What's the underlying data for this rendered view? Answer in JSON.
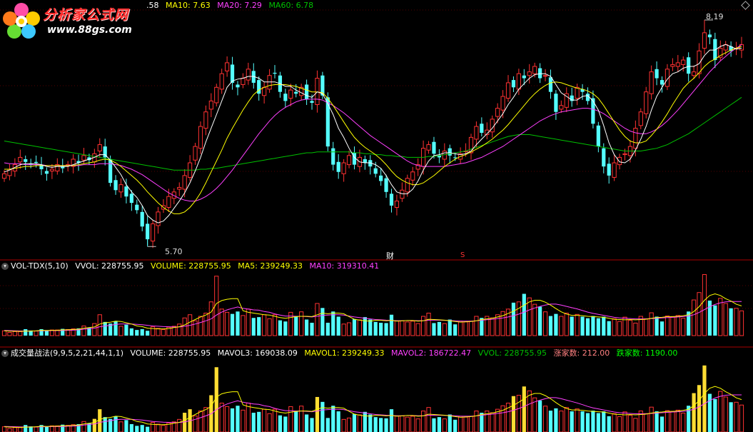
{
  "main_header": {
    "ma5_tail": ".58",
    "ma10": "MA10: 7.63",
    "ma20": "MA20: 7.29",
    "ma60": "MA60: 6.78"
  },
  "logo": {
    "title": "分析家公式网",
    "url": "www.88gs.com"
  },
  "price_labels": {
    "high": "8.19",
    "low": "5.70",
    "event_cai": "财",
    "event_s": "S"
  },
  "vol_header": {
    "name": "VOL-TDX(5,10)",
    "vvol": "VVOL: 228755.95",
    "volume": "VOLUME: 228755.95",
    "ma5": "MA5: 239249.33",
    "ma10": "MA10: 319310.41"
  },
  "strategy_header": {
    "name": "成交量战法(9,9,5,2,21,44,1,1)",
    "volume": "VOLUME: 228755.95",
    "mavol3": "MAVOL3: 169038.09",
    "mavol1": "MAVOL1: 239249.33",
    "mavol2": "MAVOL2: 186722.47",
    "vvol": "VVOL: 228755.95",
    "up": "涨家数: 212.00",
    "down": "跌家数: 1190.00"
  },
  "colors": {
    "up": "#ff3232",
    "down": "#54ffff",
    "ma5": "#ffffff",
    "ma10": "#ffff00",
    "ma20": "#ff40ff",
    "ma60": "#00c000",
    "separator": "#aa0000"
  },
  "chart_data": {
    "type": "candlestick",
    "price_range": [
      5.6,
      8.3
    ],
    "high_marker": 8.19,
    "low_marker": 5.7,
    "closes": [
      6.5,
      6.55,
      6.6,
      6.68,
      6.63,
      6.6,
      6.62,
      6.55,
      6.5,
      6.55,
      6.6,
      6.56,
      6.6,
      6.66,
      6.62,
      6.7,
      6.65,
      6.72,
      6.82,
      6.68,
      6.4,
      6.32,
      6.38,
      6.25,
      6.18,
      6.1,
      5.92,
      5.78,
      5.95,
      6.08,
      6.15,
      6.25,
      6.3,
      6.35,
      6.48,
      6.62,
      6.8,
      7.02,
      7.18,
      7.3,
      7.45,
      7.6,
      7.72,
      7.5,
      7.45,
      7.55,
      7.65,
      7.5,
      7.38,
      7.45,
      7.58,
      7.6,
      7.4,
      7.3,
      7.42,
      7.38,
      7.45,
      7.32,
      7.28,
      7.55,
      7.36,
      6.8,
      6.6,
      6.52,
      6.62,
      6.7,
      6.6,
      6.68,
      6.62,
      6.58,
      6.5,
      6.42,
      6.3,
      6.15,
      6.2,
      6.32,
      6.45,
      6.52,
      6.6,
      6.78,
      6.82,
      6.72,
      6.68,
      6.75,
      6.7,
      6.68,
      6.72,
      6.75,
      6.9,
      7.02,
      6.95,
      6.98,
      7.1,
      7.22,
      7.35,
      7.5,
      7.45,
      7.6,
      7.55,
      7.62,
      7.68,
      7.55,
      7.58,
      7.4,
      7.18,
      7.25,
      7.38,
      7.3,
      7.45,
      7.4,
      7.3,
      7.05,
      6.8,
      6.58,
      6.48,
      6.62,
      6.68,
      6.72,
      6.8,
      7.0,
      7.18,
      7.4,
      7.62,
      7.55,
      7.48,
      7.65,
      7.7,
      7.72,
      7.75,
      7.6,
      7.62,
      7.85,
      8.05,
      8.0,
      7.75,
      7.88,
      7.92,
      7.85,
      7.88,
      7.92
    ],
    "ma5": [
      6.52,
      6.54,
      6.57,
      6.6,
      6.61,
      6.61,
      6.61,
      6.6,
      6.58,
      6.57,
      6.58,
      6.58,
      6.58,
      6.6,
      6.62,
      6.64,
      6.66,
      6.68,
      6.71,
      6.71,
      6.65,
      6.57,
      6.49,
      6.38,
      6.3,
      6.24,
      6.15,
      6.04,
      5.99,
      5.96,
      5.98,
      6.04,
      6.12,
      6.2,
      6.29,
      6.4,
      6.53,
      6.68,
      6.85,
      7.0,
      7.15,
      7.3,
      7.45,
      7.52,
      7.54,
      7.55,
      7.57,
      7.57,
      7.55,
      7.51,
      7.51,
      7.51,
      7.49,
      7.46,
      7.46,
      7.42,
      7.39,
      7.36,
      7.34,
      7.4,
      7.38,
      7.27,
      7.15,
      7.0,
      6.9,
      6.78,
      6.68,
      6.63,
      6.62,
      6.62,
      6.6,
      6.56,
      6.48,
      6.38,
      6.3,
      6.28,
      6.28,
      6.33,
      6.42,
      6.54,
      6.64,
      6.7,
      6.71,
      6.73,
      6.73,
      6.72,
      6.71,
      6.72,
      6.75,
      6.82,
      6.88,
      6.94,
      7.0,
      7.08,
      7.16,
      7.26,
      7.34,
      7.43,
      7.49,
      7.55,
      7.59,
      7.6,
      7.6,
      7.57,
      7.48,
      7.39,
      7.35,
      7.31,
      7.31,
      7.35,
      7.36,
      7.3,
      7.2,
      7.03,
      6.84,
      6.71,
      6.63,
      6.62,
      6.66,
      6.76,
      6.88,
      7.02,
      7.2,
      7.35,
      7.45,
      7.54,
      7.6,
      7.62,
      7.66,
      7.68,
      7.68,
      7.71,
      7.8,
      7.86,
      7.86,
      7.9,
      7.92,
      7.9,
      7.87,
      7.88
    ],
    "ma10": [
      6.55,
      6.55,
      6.56,
      6.57,
      6.58,
      6.58,
      6.59,
      6.59,
      6.59,
      6.59,
      6.59,
      6.59,
      6.59,
      6.59,
      6.6,
      6.61,
      6.62,
      6.63,
      6.65,
      6.66,
      6.65,
      6.62,
      6.58,
      6.53,
      6.48,
      6.43,
      6.37,
      6.3,
      6.24,
      6.18,
      6.13,
      6.09,
      6.06,
      6.06,
      6.08,
      6.13,
      6.2,
      6.29,
      6.4,
      6.52,
      6.64,
      6.76,
      6.89,
      7.0,
      7.1,
      7.2,
      7.29,
      7.37,
      7.42,
      7.45,
      7.47,
      7.48,
      7.48,
      7.48,
      7.47,
      7.46,
      7.44,
      7.42,
      7.4,
      7.4,
      7.39,
      7.33,
      7.25,
      7.16,
      7.07,
      6.98,
      6.9,
      6.84,
      6.79,
      6.75,
      6.71,
      6.66,
      6.6,
      6.53,
      6.47,
      6.43,
      6.4,
      6.38,
      6.38,
      6.4,
      6.44,
      6.48,
      6.53,
      6.58,
      6.62,
      6.66,
      6.69,
      6.71,
      6.74,
      6.77,
      6.8,
      6.84,
      6.88,
      6.93,
      6.98,
      7.04,
      7.11,
      7.18,
      7.25,
      7.32,
      7.38,
      7.43,
      7.47,
      7.5,
      7.51,
      7.5,
      7.48,
      7.46,
      7.44,
      7.43,
      7.41,
      7.38,
      7.33,
      7.25,
      7.16,
      7.07,
      6.98,
      6.91,
      6.86,
      6.84,
      6.84,
      6.86,
      6.92,
      6.99,
      7.07,
      7.16,
      7.26,
      7.35,
      7.44,
      7.5,
      7.55,
      7.61,
      7.68,
      7.73,
      7.76,
      7.8,
      7.83,
      7.86,
      7.88,
      7.9
    ],
    "ma20": [
      6.62,
      6.61,
      6.61,
      6.61,
      6.6,
      6.6,
      6.6,
      6.6,
      6.59,
      6.59,
      6.59,
      6.59,
      6.59,
      6.59,
      6.59,
      6.6,
      6.6,
      6.6,
      6.61,
      6.61,
      6.61,
      6.6,
      6.59,
      6.57,
      6.55,
      6.52,
      6.49,
      6.45,
      6.41,
      6.37,
      6.33,
      6.29,
      6.26,
      6.23,
      6.21,
      6.2,
      6.2,
      6.22,
      6.25,
      6.29,
      6.34,
      6.4,
      6.47,
      6.54,
      6.62,
      6.7,
      6.78,
      6.86,
      6.94,
      7.01,
      7.08,
      7.14,
      7.19,
      7.23,
      7.26,
      7.29,
      7.31,
      7.32,
      7.32,
      7.32,
      7.31,
      7.28,
      7.25,
      7.21,
      7.17,
      7.12,
      7.07,
      7.02,
      6.97,
      6.92,
      6.88,
      6.84,
      6.8,
      6.76,
      6.72,
      6.68,
      6.64,
      6.61,
      6.59,
      6.58,
      6.58,
      6.58,
      6.58,
      6.58,
      6.59,
      6.6,
      6.61,
      6.62,
      6.64,
      6.66,
      6.68,
      6.71,
      6.74,
      6.77,
      6.8,
      6.84,
      6.88,
      6.92,
      6.96,
      7.0,
      7.04,
      7.08,
      7.11,
      7.14,
      7.16,
      7.18,
      7.19,
      7.2,
      7.21,
      7.22,
      7.22,
      7.21,
      7.19,
      7.16,
      7.12,
      7.08,
      7.04,
      7.0,
      6.97,
      6.95,
      6.94,
      6.94,
      6.96,
      6.99,
      7.03,
      7.08,
      7.14,
      7.2,
      7.27,
      7.34,
      7.41,
      7.48,
      7.55,
      7.62,
      7.68,
      7.74,
      7.79,
      7.84,
      7.88,
      7.92
    ],
    "ma60": [
      6.86,
      6.85,
      6.84,
      6.83,
      6.82,
      6.81,
      6.8,
      6.79,
      6.78,
      6.77,
      6.76,
      6.75,
      6.74,
      6.73,
      6.72,
      6.71,
      6.7,
      6.69,
      6.68,
      6.67,
      6.66,
      6.65,
      6.64,
      6.63,
      6.62,
      6.61,
      6.6,
      6.59,
      6.58,
      6.57,
      6.56,
      6.55,
      6.54,
      6.54,
      6.54,
      6.54,
      6.54,
      6.55,
      6.55,
      6.56,
      6.56,
      6.57,
      6.58,
      6.59,
      6.6,
      6.61,
      6.62,
      6.63,
      6.64,
      6.65,
      6.66,
      6.67,
      6.68,
      6.69,
      6.7,
      6.71,
      6.72,
      6.73,
      6.73,
      6.74,
      6.74,
      6.74,
      6.74,
      6.74,
      6.74,
      6.74,
      6.73,
      6.73,
      6.72,
      6.72,
      6.71,
      6.71,
      6.7,
      6.7,
      6.69,
      6.69,
      6.68,
      6.68,
      6.68,
      6.68,
      6.69,
      6.69,
      6.7,
      6.71,
      6.72,
      6.73,
      6.74,
      6.75,
      6.77,
      6.79,
      6.81,
      6.83,
      6.85,
      6.87,
      6.89,
      6.91,
      6.92,
      6.93,
      6.93,
      6.93,
      6.92,
      6.91,
      6.9,
      6.89,
      6.88,
      6.87,
      6.86,
      6.85,
      6.84,
      6.83,
      6.82,
      6.81,
      6.8,
      6.79,
      6.78,
      6.77,
      6.76,
      6.75,
      6.75,
      6.75,
      6.75,
      6.76,
      6.77,
      6.78,
      6.8,
      6.82,
      6.85,
      6.88,
      6.91,
      6.94,
      6.98,
      7.02,
      7.06,
      7.1,
      7.14,
      7.18,
      7.22,
      7.26,
      7.3,
      7.34
    ],
    "volume_range": [
      0,
      400000
    ],
    "volumes": [
      30000,
      20000,
      25000,
      25000,
      40000,
      32000,
      28000,
      40000,
      30000,
      35000,
      35000,
      42000,
      38000,
      42000,
      45000,
      60000,
      50000,
      75000,
      130000,
      85000,
      75000,
      90000,
      58000,
      68000,
      45000,
      35000,
      40000,
      30000,
      55000,
      45000,
      38000,
      52000,
      58000,
      72000,
      110000,
      130000,
      92000,
      120000,
      140000,
      210000,
      370000,
      165000,
      145000,
      135000,
      150000,
      125000,
      165000,
      110000,
      115000,
      130000,
      105000,
      130000,
      95000,
      88000,
      145000,
      120000,
      148000,
      100000,
      80000,
      200000,
      172000,
      80000,
      150000,
      118000,
      72000,
      80000,
      103000,
      98000,
      115000,
      100000,
      85000,
      80000,
      78000,
      130000,
      92000,
      92000,
      85000,
      90000,
      75000,
      120000,
      140000,
      78000,
      85000,
      75000,
      100000,
      70000,
      90000,
      85000,
      90000,
      120000,
      110000,
      120000,
      110000,
      130000,
      150000,
      165000,
      205000,
      210000,
      260000,
      235000,
      195000,
      180000,
      148000,
      122000,
      135000,
      120000,
      140000,
      118000,
      132000,
      118000,
      108000,
      122000,
      108000,
      118000,
      90000,
      105000,
      88000,
      115000,
      95000,
      78000,
      120000,
      105000,
      142000,
      118000,
      88000,
      122000,
      118000,
      125000,
      108000,
      150000,
      222000,
      268000,
      380000,
      218000,
      188000,
      232000,
      200000,
      170000,
      170000,
      154000
    ],
    "vol_ma5": [
      30000,
      28000,
      27000,
      26000,
      28000,
      28000,
      30000,
      33000,
      32000,
      33000,
      33000,
      36000,
      36000,
      38000,
      40000,
      46000,
      50000,
      54000,
      72000,
      80000,
      83000,
      90000,
      88000,
      80000,
      72000,
      60000,
      56000,
      46000,
      44000,
      42000,
      42000,
      44000,
      50000,
      55000,
      66000,
      84000,
      100000,
      116000,
      128000,
      146000,
      200000,
      218000,
      226000,
      230000,
      230000,
      155000,
      145000,
      140000,
      135000,
      130000,
      128000,
      120000,
      112000,
      108000,
      113000,
      118000,
      120000,
      120000,
      118000,
      130000,
      140000,
      136000,
      140000,
      140000,
      136000,
      118000,
      102000,
      96000,
      92000,
      90000,
      95000,
      95000,
      92000,
      95000,
      90000,
      92000,
      94000,
      94000,
      90000,
      92000,
      102000,
      100000,
      98000,
      96000,
      92000,
      88000,
      84000,
      86000,
      88000,
      92000,
      100000,
      104000,
      108000,
      116000,
      124000,
      138000,
      152000,
      170000,
      190000,
      210000,
      220000,
      220000,
      208000,
      190000,
      168000,
      148000,
      134000,
      126000,
      126000,
      124000,
      120000,
      118000,
      116000,
      114000,
      108000,
      102000,
      100000,
      98000,
      100000,
      98000,
      100000,
      102000,
      108000,
      112000,
      114000,
      118000,
      118000,
      120000,
      124000,
      130000,
      150000,
      180000,
      220000,
      250000,
      260000,
      250000,
      230000,
      215000,
      195000,
      185000
    ],
    "vol_ma10": [
      32000,
      31000,
      30000,
      29000,
      29000,
      29000,
      29000,
      30000,
      30000,
      31000,
      31000,
      32000,
      33000,
      34000,
      36000,
      40000,
      43000,
      46000,
      55000,
      60000,
      64000,
      70000,
      72000,
      72000,
      72000,
      70000,
      68000,
      64000,
      60000,
      58000,
      56000,
      55000,
      54000,
      54000,
      58000,
      64000,
      72000,
      82000,
      92000,
      104000,
      128000,
      146000,
      160000,
      170000,
      178000,
      170000,
      165000,
      160000,
      158000,
      150000,
      145000,
      135000,
      128000,
      122000,
      122000,
      120000,
      120000,
      118000,
      116000,
      120000,
      126000,
      128000,
      130000,
      130000,
      128000,
      122000,
      116000,
      112000,
      108000,
      104000,
      100000,
      98000,
      96000,
      95000,
      93000,
      93000,
      94000,
      94000,
      93000,
      93000,
      96000,
      96000,
      96000,
      95000,
      94000,
      92000,
      90000,
      90000,
      90000,
      92000,
      96000,
      99000,
      102000,
      106000,
      110000,
      116000,
      124000,
      134000,
      146000,
      160000,
      172000,
      182000,
      190000,
      196000,
      196000,
      190000,
      182000,
      174000,
      166000,
      156000,
      146000,
      138000,
      132000,
      126000,
      120000,
      114000,
      110000,
      108000,
      106000,
      104000,
      104000,
      104000,
      106000,
      108000,
      110000,
      112000,
      114000,
      116000,
      118000,
      122000,
      130000,
      144000,
      162000,
      180000,
      194000,
      204000,
      210000,
      212000,
      212000,
      212000
    ],
    "mavol_range": [
      0,
      420000
    ]
  }
}
